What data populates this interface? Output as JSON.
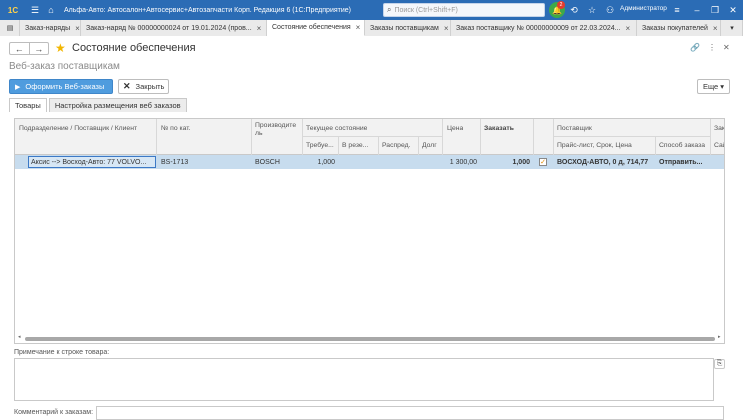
{
  "window": {
    "logo": "1С",
    "title": "Альфа-Авто: Автосалон+Автосервис+Автозапчасти Корп. Редакция 6  (1С:Предприятие)",
    "search_placeholder": "Поиск (Ctrl+Shift+F)",
    "notifications_count": "2",
    "user": "Администратор"
  },
  "tabs": [
    {
      "label": "Заказ-наряды"
    },
    {
      "label": "Заказ-наряд № 00000000024 от 19.01.2024 (пров..."
    },
    {
      "label": "Состояние обеспечения"
    },
    {
      "label": "Заказы поставщикам"
    },
    {
      "label": "Заказ поставщику № 00000000009 от 22.03.2024..."
    },
    {
      "label": "Заказы покупателей"
    }
  ],
  "page": {
    "title": "Состояние обеспечения",
    "subtitle": "Веб-заказ поставщикам",
    "submit_button": "Оформить Веб-заказы",
    "close_button": "Закрыть",
    "more_button": "Еще"
  },
  "form_tabs": [
    {
      "label": "Товары"
    },
    {
      "label": "Настройка размещения веб заказов"
    }
  ],
  "table": {
    "headers": {
      "subdivision": "Подразделение / Поставщик / Клиент",
      "cat_no": "№ по кат.",
      "manufacturer": "Производите ль",
      "current_state": "Текущее состояние",
      "required": "Требуе...",
      "reserved": "В резе...",
      "distributed": "Распред.",
      "debt": "Долг",
      "price": "Цена",
      "order": "Заказать",
      "supplier": "Поставщик",
      "pricelist": "Прайс-лист, Срок, Цена",
      "order_method": "Способ заказа",
      "extra_top": "Зак",
      "extra_bottom": "Сай"
    },
    "rows": [
      {
        "subdivision": "Аксис  --> Восход-Авто: 77 VOLVO...",
        "cat_no": "BS-1713",
        "manufacturer": "BOSCH",
        "required": "1,000",
        "price": "1 300,00",
        "order": "1,000",
        "checked": true,
        "pricelist": "ВОСХОД-АВТО, 0 д, 714,77",
        "order_method": "Отправить..."
      }
    ]
  },
  "note_label": "Примечание к строке товара:",
  "comment_label": "Комментарий к заказам:"
}
